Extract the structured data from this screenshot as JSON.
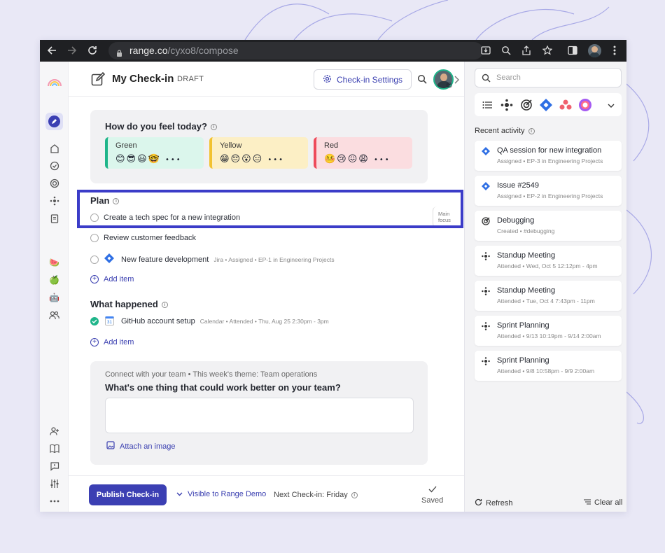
{
  "browser": {
    "url_domain": "range.co",
    "url_path": "/cyxo8/compose"
  },
  "header": {
    "title": "My Check-in",
    "status": "DRAFT",
    "settings_label": "Check-in Settings"
  },
  "mood": {
    "question": "How do you feel today?",
    "options": [
      {
        "label": "Green",
        "emojis": "😊😎😃🤓",
        "color": "#1fb58a",
        "bg": "#dbf6ec"
      },
      {
        "label": "Yellow",
        "emojis": "😁😔😮😑",
        "color": "#f2c230",
        "bg": "#fcefc5"
      },
      {
        "label": "Red",
        "emojis": "🤒😢😖😩",
        "color": "#ee4b5b",
        "bg": "#fbdde0"
      }
    ],
    "more": "•••"
  },
  "plan": {
    "heading": "Plan",
    "items": [
      {
        "text": "Create a tech spec for a new integration",
        "main_focus": "Main focus"
      },
      {
        "text": "Review customer feedback"
      },
      {
        "text": "New feature development",
        "meta": "Jira • Assigned • EP-1 in Engineering Projects"
      }
    ],
    "add_item": "Add item"
  },
  "what_happened": {
    "heading": "What happened",
    "items": [
      {
        "text": "GitHub account setup",
        "meta": "Calendar • Attended • Thu, Aug 25 2:30pm - 3pm"
      }
    ],
    "add_item": "Add item"
  },
  "team_question": {
    "subtitle": "Connect with your team • This week's theme: Team operations",
    "question": "What's one thing that could work better on your team?",
    "answer": "",
    "attach_label": "Attach an image"
  },
  "footer": {
    "publish_label": "Publish Check-in",
    "visibility_label": "Visible to Range Demo",
    "next_checkin": "Next Check-in: Friday",
    "saved_label": "Saved"
  },
  "sidebar": {
    "search_placeholder": "Search",
    "recent_title": "Recent activity",
    "activities": [
      {
        "icon": "jira-icon",
        "title": "QA session for new integration",
        "sub": "Assigned • EP-3 in Engineering Projects"
      },
      {
        "icon": "jira-icon",
        "title": "Issue #2549",
        "sub": "Assigned • EP-2 in Engineering Projects"
      },
      {
        "icon": "target-icon",
        "title": "Debugging",
        "sub": "Created • #debugging"
      },
      {
        "icon": "meeting-icon",
        "title": "Standup Meeting",
        "sub": "Attended • Wed, Oct 5 12:12pm - 4pm"
      },
      {
        "icon": "meeting-icon",
        "title": "Standup Meeting",
        "sub": "Attended • Tue, Oct 4 7:43pm - 11pm"
      },
      {
        "icon": "meeting-icon",
        "title": "Sprint Planning",
        "sub": "Attended • 9/13 10:19pm - 9/14 2:00am"
      },
      {
        "icon": "meeting-icon",
        "title": "Sprint Planning",
        "sub": "Attended • 9/8 10:58pm - 9/9 2:00am"
      }
    ],
    "refresh_label": "Refresh",
    "clear_label": "Clear all"
  },
  "colors": {
    "accent": "#3b3fb3",
    "highlight": "#3b3cc8"
  }
}
